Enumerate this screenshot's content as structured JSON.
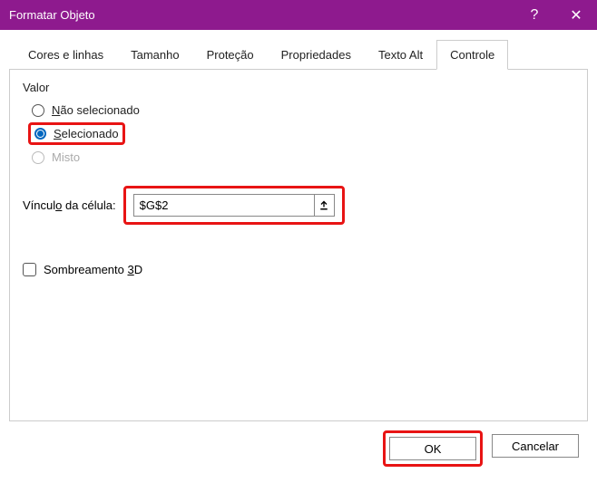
{
  "titlebar": {
    "title": "Formatar Objeto",
    "help": "?",
    "close": "✕"
  },
  "tabs": {
    "colors_lines": "Cores e linhas",
    "size": "Tamanho",
    "protection": "Proteção",
    "properties": "Propriedades",
    "alt_text": "Texto Alt",
    "control": "Controle"
  },
  "group": {
    "value_label": "Valor"
  },
  "radios": {
    "unselected_pre": "N",
    "unselected_rest": "ão selecionado",
    "selected_pre": "S",
    "selected_rest": "elecionado",
    "mixed": "Misto"
  },
  "cell_link": {
    "label_pre": "Víncul",
    "label_ul": "o",
    "label_post": " da célula:",
    "value": "$G$2"
  },
  "shading": {
    "label_pre": "Sombreamento ",
    "label_ul": "3",
    "label_post": "D"
  },
  "buttons": {
    "ok": "OK",
    "cancel": "Cancelar"
  }
}
